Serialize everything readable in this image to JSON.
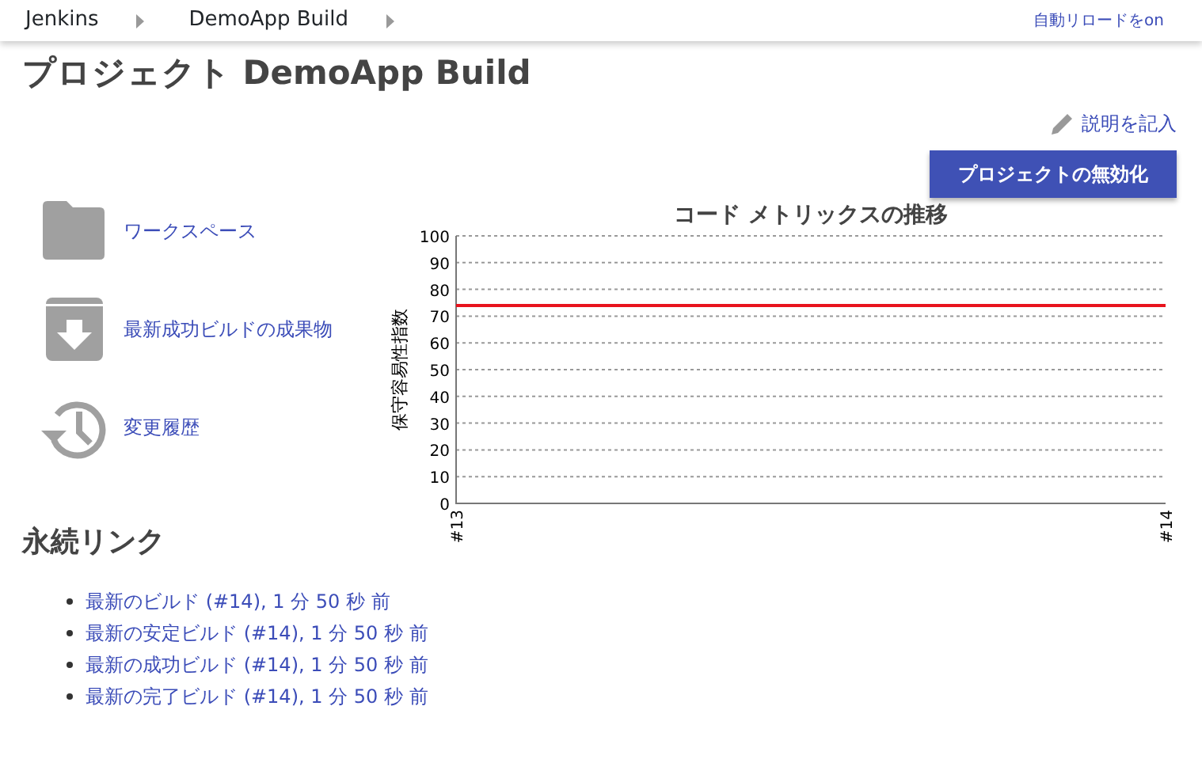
{
  "breadcrumbs": [
    {
      "label": "Jenkins"
    },
    {
      "label": "DemoApp Build"
    }
  ],
  "auto_refresh": "自動リロードをon",
  "title": "プロジェクト DemoApp Build",
  "edit_description": "説明を記入",
  "disable_button": "プロジェクトの無効化",
  "tasks": [
    {
      "kind": "folder",
      "label": "ワークスペース"
    },
    {
      "kind": "archive",
      "label": "最新成功ビルドの成果物"
    },
    {
      "kind": "history",
      "label": "変更履歴"
    }
  ],
  "chart": {
    "chart_data": {
      "type": "line",
      "title": "コード メトリックスの推移",
      "ylabel": "保守容易性指数",
      "categories": [
        "#13",
        "#14"
      ],
      "ylim": [
        0,
        100
      ],
      "yticks": [
        0,
        10,
        20,
        30,
        40,
        50,
        60,
        70,
        80,
        90,
        100
      ],
      "series": [
        {
          "color": "#e8131d",
          "values": [
            74,
            74
          ]
        }
      ]
    }
  },
  "permalinks": {
    "heading": "永続リンク",
    "items": [
      "最新のビルド (#14), 1 分 50 秒 前",
      "最新の安定ビルド (#14), 1 分 50 秒 前",
      "最新の成功ビルド (#14), 1 分 50 秒 前",
      "最新の完了ビルド (#14), 1 分 50 秒 前"
    ]
  }
}
